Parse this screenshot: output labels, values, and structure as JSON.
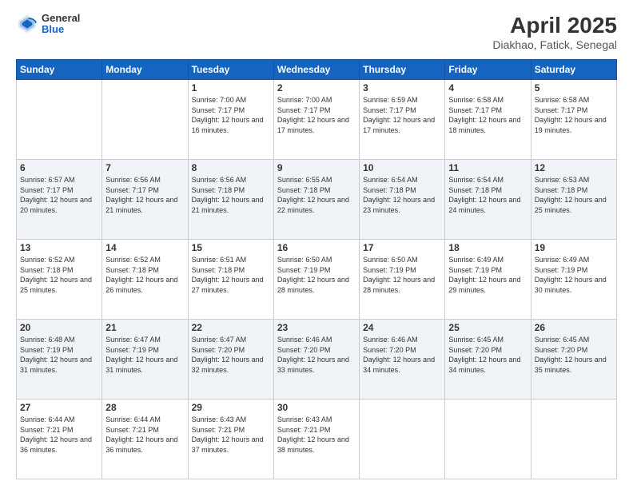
{
  "header": {
    "logo": {
      "line1": "General",
      "line2": "Blue"
    },
    "title": "April 2025",
    "subtitle": "Diakhao, Fatick, Senegal"
  },
  "weekdays": [
    "Sunday",
    "Monday",
    "Tuesday",
    "Wednesday",
    "Thursday",
    "Friday",
    "Saturday"
  ],
  "weeks": [
    [
      {
        "day": "",
        "info": ""
      },
      {
        "day": "",
        "info": ""
      },
      {
        "day": "1",
        "info": "Sunrise: 7:00 AM\nSunset: 7:17 PM\nDaylight: 12 hours and 16 minutes."
      },
      {
        "day": "2",
        "info": "Sunrise: 7:00 AM\nSunset: 7:17 PM\nDaylight: 12 hours and 17 minutes."
      },
      {
        "day": "3",
        "info": "Sunrise: 6:59 AM\nSunset: 7:17 PM\nDaylight: 12 hours and 17 minutes."
      },
      {
        "day": "4",
        "info": "Sunrise: 6:58 AM\nSunset: 7:17 PM\nDaylight: 12 hours and 18 minutes."
      },
      {
        "day": "5",
        "info": "Sunrise: 6:58 AM\nSunset: 7:17 PM\nDaylight: 12 hours and 19 minutes."
      }
    ],
    [
      {
        "day": "6",
        "info": "Sunrise: 6:57 AM\nSunset: 7:17 PM\nDaylight: 12 hours and 20 minutes."
      },
      {
        "day": "7",
        "info": "Sunrise: 6:56 AM\nSunset: 7:17 PM\nDaylight: 12 hours and 21 minutes."
      },
      {
        "day": "8",
        "info": "Sunrise: 6:56 AM\nSunset: 7:18 PM\nDaylight: 12 hours and 21 minutes."
      },
      {
        "day": "9",
        "info": "Sunrise: 6:55 AM\nSunset: 7:18 PM\nDaylight: 12 hours and 22 minutes."
      },
      {
        "day": "10",
        "info": "Sunrise: 6:54 AM\nSunset: 7:18 PM\nDaylight: 12 hours and 23 minutes."
      },
      {
        "day": "11",
        "info": "Sunrise: 6:54 AM\nSunset: 7:18 PM\nDaylight: 12 hours and 24 minutes."
      },
      {
        "day": "12",
        "info": "Sunrise: 6:53 AM\nSunset: 7:18 PM\nDaylight: 12 hours and 25 minutes."
      }
    ],
    [
      {
        "day": "13",
        "info": "Sunrise: 6:52 AM\nSunset: 7:18 PM\nDaylight: 12 hours and 25 minutes."
      },
      {
        "day": "14",
        "info": "Sunrise: 6:52 AM\nSunset: 7:18 PM\nDaylight: 12 hours and 26 minutes."
      },
      {
        "day": "15",
        "info": "Sunrise: 6:51 AM\nSunset: 7:18 PM\nDaylight: 12 hours and 27 minutes."
      },
      {
        "day": "16",
        "info": "Sunrise: 6:50 AM\nSunset: 7:19 PM\nDaylight: 12 hours and 28 minutes."
      },
      {
        "day": "17",
        "info": "Sunrise: 6:50 AM\nSunset: 7:19 PM\nDaylight: 12 hours and 28 minutes."
      },
      {
        "day": "18",
        "info": "Sunrise: 6:49 AM\nSunset: 7:19 PM\nDaylight: 12 hours and 29 minutes."
      },
      {
        "day": "19",
        "info": "Sunrise: 6:49 AM\nSunset: 7:19 PM\nDaylight: 12 hours and 30 minutes."
      }
    ],
    [
      {
        "day": "20",
        "info": "Sunrise: 6:48 AM\nSunset: 7:19 PM\nDaylight: 12 hours and 31 minutes."
      },
      {
        "day": "21",
        "info": "Sunrise: 6:47 AM\nSunset: 7:19 PM\nDaylight: 12 hours and 31 minutes."
      },
      {
        "day": "22",
        "info": "Sunrise: 6:47 AM\nSunset: 7:20 PM\nDaylight: 12 hours and 32 minutes."
      },
      {
        "day": "23",
        "info": "Sunrise: 6:46 AM\nSunset: 7:20 PM\nDaylight: 12 hours and 33 minutes."
      },
      {
        "day": "24",
        "info": "Sunrise: 6:46 AM\nSunset: 7:20 PM\nDaylight: 12 hours and 34 minutes."
      },
      {
        "day": "25",
        "info": "Sunrise: 6:45 AM\nSunset: 7:20 PM\nDaylight: 12 hours and 34 minutes."
      },
      {
        "day": "26",
        "info": "Sunrise: 6:45 AM\nSunset: 7:20 PM\nDaylight: 12 hours and 35 minutes."
      }
    ],
    [
      {
        "day": "27",
        "info": "Sunrise: 6:44 AM\nSunset: 7:21 PM\nDaylight: 12 hours and 36 minutes."
      },
      {
        "day": "28",
        "info": "Sunrise: 6:44 AM\nSunset: 7:21 PM\nDaylight: 12 hours and 36 minutes."
      },
      {
        "day": "29",
        "info": "Sunrise: 6:43 AM\nSunset: 7:21 PM\nDaylight: 12 hours and 37 minutes."
      },
      {
        "day": "30",
        "info": "Sunrise: 6:43 AM\nSunset: 7:21 PM\nDaylight: 12 hours and 38 minutes."
      },
      {
        "day": "",
        "info": ""
      },
      {
        "day": "",
        "info": ""
      },
      {
        "day": "",
        "info": ""
      }
    ]
  ]
}
